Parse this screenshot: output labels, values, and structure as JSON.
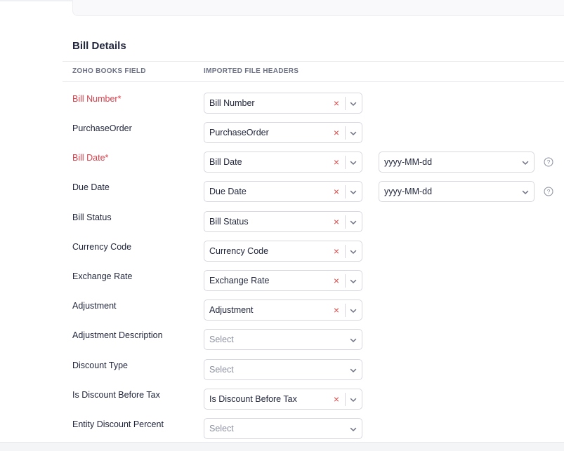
{
  "section": {
    "title": "Bill Details"
  },
  "columns": {
    "books_field": "ZOHO BOOKS FIELD",
    "file_headers": "IMPORTED FILE HEADERS"
  },
  "rows": [
    {
      "label": "Bill Number*",
      "required": true,
      "value": "Bill Number",
      "placeholder": "",
      "format": ""
    },
    {
      "label": "PurchaseOrder",
      "required": false,
      "value": "PurchaseOrder",
      "placeholder": "",
      "format": ""
    },
    {
      "label": "Bill Date*",
      "required": true,
      "value": "Bill Date",
      "placeholder": "",
      "format": "yyyy-MM-dd"
    },
    {
      "label": "Due Date",
      "required": false,
      "value": "Due Date",
      "placeholder": "",
      "format": "yyyy-MM-dd"
    },
    {
      "label": "Bill Status",
      "required": false,
      "value": "Bill Status",
      "placeholder": "",
      "format": ""
    },
    {
      "label": "Currency Code",
      "required": false,
      "value": "Currency Code",
      "placeholder": "",
      "format": ""
    },
    {
      "label": "Exchange Rate",
      "required": false,
      "value": "Exchange Rate",
      "placeholder": "",
      "format": ""
    },
    {
      "label": "Adjustment",
      "required": false,
      "value": "Adjustment",
      "placeholder": "",
      "format": ""
    },
    {
      "label": "Adjustment Description",
      "required": false,
      "value": "",
      "placeholder": "Select",
      "format": ""
    },
    {
      "label": "Discount Type",
      "required": false,
      "value": "",
      "placeholder": "Select",
      "format": ""
    },
    {
      "label": "Is Discount Before Tax",
      "required": false,
      "value": "Is Discount Before Tax",
      "placeholder": "",
      "format": ""
    },
    {
      "label": "Entity Discount Percent",
      "required": false,
      "value": "",
      "placeholder": "Select",
      "format": ""
    }
  ],
  "icons": {
    "clear": "close-icon",
    "dropdown": "chevron-down-icon",
    "help": "help-circle-icon"
  },
  "colors": {
    "required_label": "#d6414c",
    "clear_icon": "#e04a4a",
    "border": "#d6d8de",
    "text": "#21263c"
  }
}
